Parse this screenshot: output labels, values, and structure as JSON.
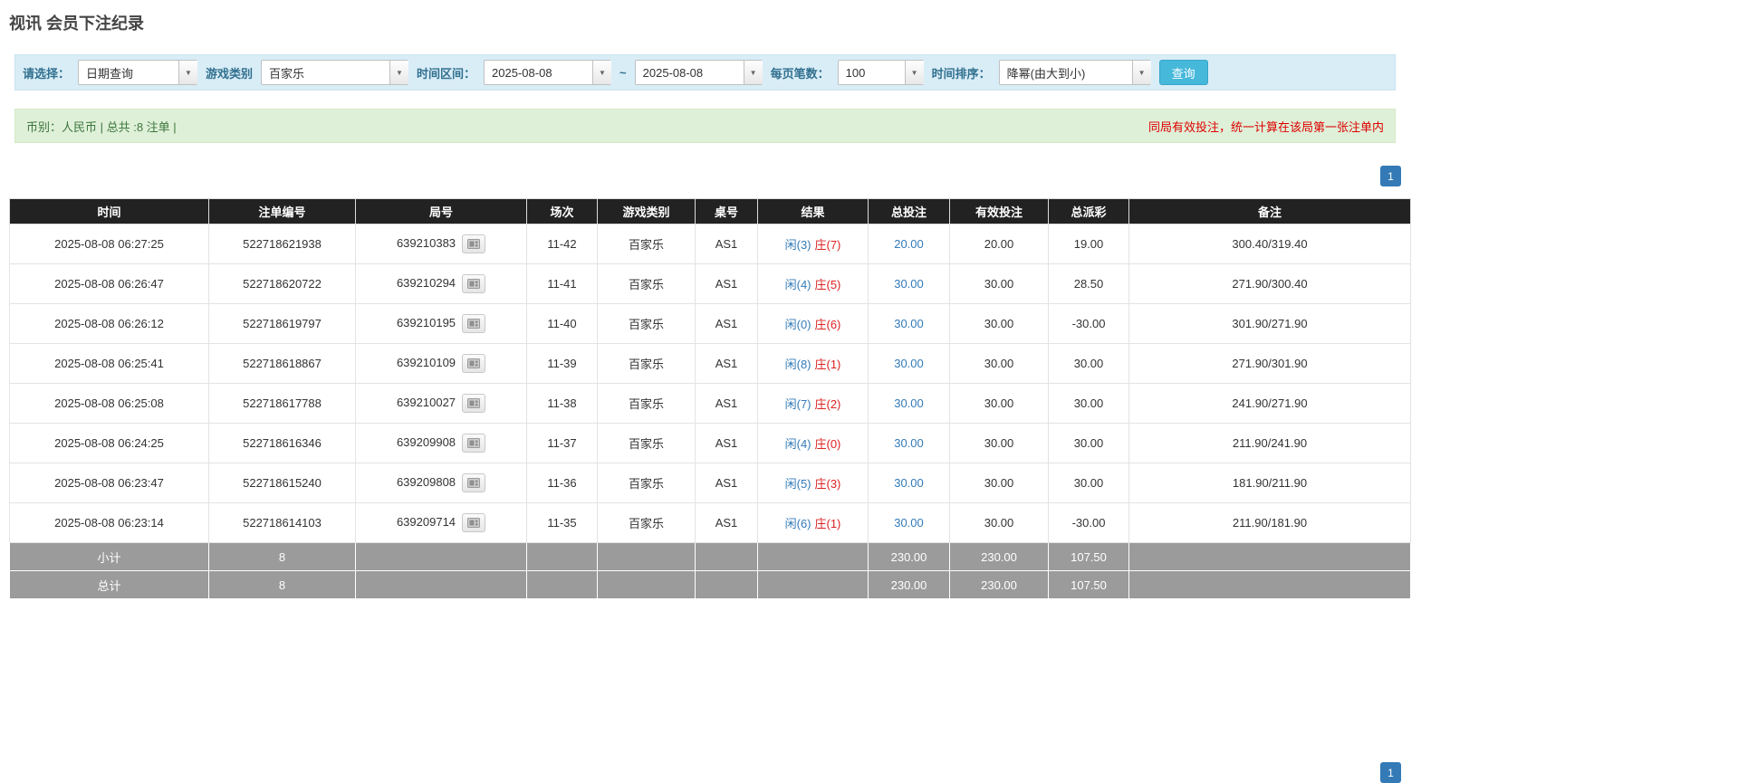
{
  "page": {
    "title": "视讯 会员下注纪录"
  },
  "colors": {
    "accent-blue": "#46b8da",
    "pagination-blue": "#337ab7",
    "link-blue": "#337ab7",
    "player-blue": "#337ab7",
    "banker-red": "#dd2222",
    "negative-red": "#dd2222",
    "notice-red": "#dd0000",
    "filter-bg": "#d9edf7",
    "filter-label": "#31708f",
    "summary-bg": "#dff0d8",
    "summary-text": "#3c763d",
    "header-bg": "#222222",
    "footer-bg": "#9b9b9b"
  },
  "filters": {
    "select_label": "请选择：",
    "select_value": "日期查询",
    "game_type_label": "游戏类别",
    "game_type_value": "百家乐",
    "date_range_label": "时间区间：",
    "date_from": "2025-08-08",
    "date_separator": "~",
    "date_to": "2025-08-08",
    "page_size_label": "每页笔数：",
    "page_size_value": "100",
    "sort_label": "时间排序：",
    "sort_value": "降幂(由大到小)",
    "search_button": "查询",
    "caret": "▼"
  },
  "summary": {
    "left": "币别：人民币 | 总共 :8 注单 |",
    "right": "同局有效投注，统一计算在该局第一张注单内"
  },
  "pagination": {
    "page": "1"
  },
  "table": {
    "headers": [
      "时间",
      "注单编号",
      "局号",
      "场次",
      "游戏类别",
      "桌号",
      "结果",
      "总投注",
      "有效投注",
      "总派彩",
      "备注"
    ],
    "rows": [
      {
        "time": "2025-08-08 06:27:25",
        "bet_id": "522718621938",
        "round": "639210383",
        "session": "11-42",
        "game": "百家乐",
        "table_no": "AS1",
        "result_player": "闲(3)",
        "result_banker": "庄(7)",
        "total_bet": "20.00",
        "valid_bet": "20.00",
        "payout": "19.00",
        "payout_negative": false,
        "note": "300.40/319.40"
      },
      {
        "time": "2025-08-08 06:26:47",
        "bet_id": "522718620722",
        "round": "639210294",
        "session": "11-41",
        "game": "百家乐",
        "table_no": "AS1",
        "result_player": "闲(4)",
        "result_banker": "庄(5)",
        "total_bet": "30.00",
        "valid_bet": "30.00",
        "payout": "28.50",
        "payout_negative": false,
        "note": "271.90/300.40"
      },
      {
        "time": "2025-08-08 06:26:12",
        "bet_id": "522718619797",
        "round": "639210195",
        "session": "11-40",
        "game": "百家乐",
        "table_no": "AS1",
        "result_player": "闲(0)",
        "result_banker": "庄(6)",
        "total_bet": "30.00",
        "valid_bet": "30.00",
        "payout": "-30.00",
        "payout_negative": true,
        "note": "301.90/271.90"
      },
      {
        "time": "2025-08-08 06:25:41",
        "bet_id": "522718618867",
        "round": "639210109",
        "session": "11-39",
        "game": "百家乐",
        "table_no": "AS1",
        "result_player": "闲(8)",
        "result_banker": "庄(1)",
        "total_bet": "30.00",
        "valid_bet": "30.00",
        "payout": "30.00",
        "payout_negative": false,
        "note": "271.90/301.90"
      },
      {
        "time": "2025-08-08 06:25:08",
        "bet_id": "522718617788",
        "round": "639210027",
        "session": "11-38",
        "game": "百家乐",
        "table_no": "AS1",
        "result_player": "闲(7)",
        "result_banker": "庄(2)",
        "total_bet": "30.00",
        "valid_bet": "30.00",
        "payout": "30.00",
        "payout_negative": false,
        "note": "241.90/271.90"
      },
      {
        "time": "2025-08-08 06:24:25",
        "bet_id": "522718616346",
        "round": "639209908",
        "session": "11-37",
        "game": "百家乐",
        "table_no": "AS1",
        "result_player": "闲(4)",
        "result_banker": "庄(0)",
        "total_bet": "30.00",
        "valid_bet": "30.00",
        "payout": "30.00",
        "payout_negative": false,
        "note": "211.90/241.90"
      },
      {
        "time": "2025-08-08 06:23:47",
        "bet_id": "522718615240",
        "round": "639209808",
        "session": "11-36",
        "game": "百家乐",
        "table_no": "AS1",
        "result_player": "闲(5)",
        "result_banker": "庄(3)",
        "total_bet": "30.00",
        "valid_bet": "30.00",
        "payout": "30.00",
        "payout_negative": false,
        "note": "181.90/211.90"
      },
      {
        "time": "2025-08-08 06:23:14",
        "bet_id": "522718614103",
        "round": "639209714",
        "session": "11-35",
        "game": "百家乐",
        "table_no": "AS1",
        "result_player": "闲(6)",
        "result_banker": "庄(1)",
        "total_bet": "30.00",
        "valid_bet": "30.00",
        "payout": "-30.00",
        "payout_negative": true,
        "note": "211.90/181.90"
      }
    ],
    "subtotal": {
      "label": "小计",
      "count": "8",
      "total_bet": "230.00",
      "valid_bet": "230.00",
      "payout": "107.50"
    },
    "total": {
      "label": "总计",
      "count": "8",
      "total_bet": "230.00",
      "valid_bet": "230.00",
      "payout": "107.50"
    }
  }
}
